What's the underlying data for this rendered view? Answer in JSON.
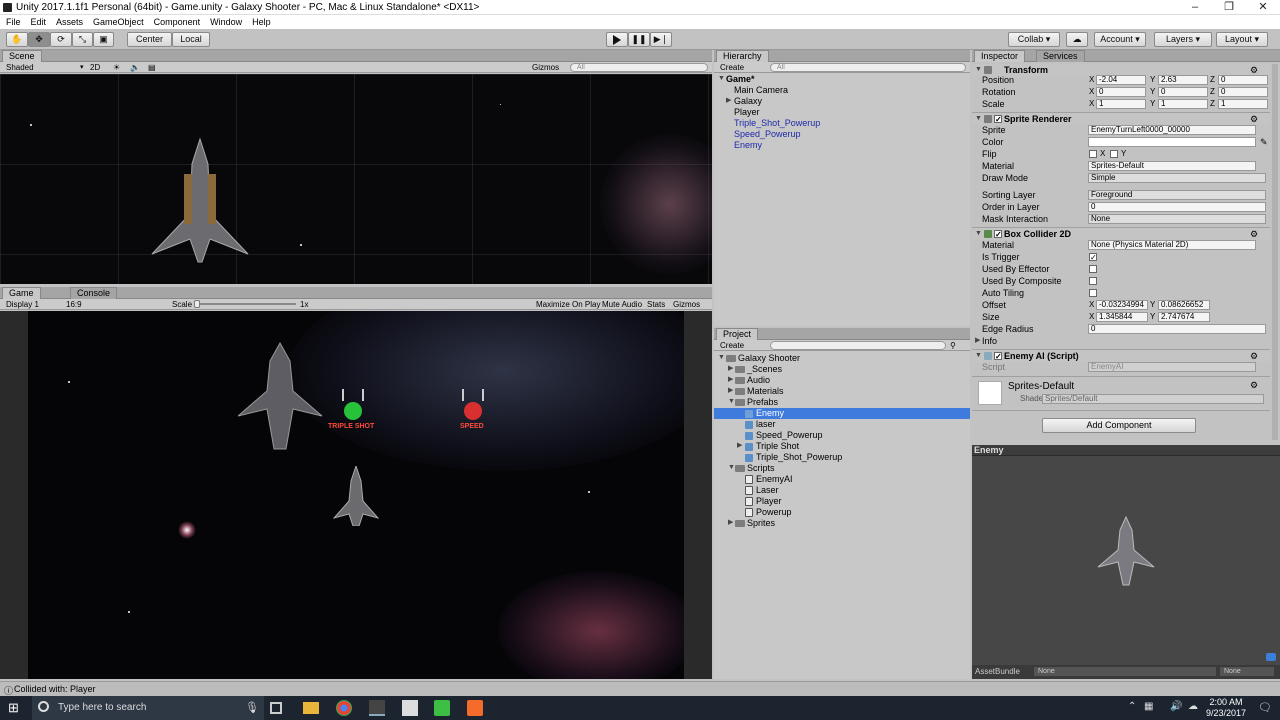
{
  "window": {
    "title": "Unity 2017.1.1f1 Personal (64bit) - Game.unity - Galaxy Shooter - PC, Mac & Linux Standalone* <DX11>"
  },
  "menu": [
    "File",
    "Edit",
    "Assets",
    "GameObject",
    "Component",
    "Window",
    "Help"
  ],
  "toolbar": {
    "center": "Center",
    "local": "Local",
    "collab": "Collab ▾",
    "account": "Account",
    "layers": "Layers",
    "layout": "Layout"
  },
  "scene": {
    "tab": "Scene",
    "shading": "Shaded",
    "mode2d": "2D",
    "gizmos": "Gizmos",
    "search_placeholder": "All"
  },
  "game": {
    "tab": "Game",
    "console_tab": "Console",
    "display": "Display 1",
    "aspect": "16:9",
    "scale_label": "Scale",
    "scale_value": "1x",
    "maximize": "Maximize On Play",
    "mute": "Mute Audio",
    "stats": "Stats",
    "gizmos": "Gizmos",
    "powerup1": "TRIPLE SHOT",
    "powerup2": "SPEED"
  },
  "hierarchy": {
    "tab": "Hierarchy",
    "create": "Create",
    "search_placeholder": "All",
    "scene_name": "Game*",
    "items": [
      "Main Camera",
      "Galaxy",
      "Player",
      "Triple_Shot_Powerup",
      "Speed_Powerup",
      "Enemy"
    ]
  },
  "project": {
    "tab": "Project",
    "create": "Create",
    "root": "Galaxy Shooter",
    "items": [
      "_Scenes",
      "Audio",
      "Materials",
      "Prefabs",
      "Enemy",
      "laser",
      "Speed_Powerup",
      "Triple Shot",
      "Triple_Shot_Powerup",
      "Scripts",
      "EnemyAI",
      "Laser",
      "Player",
      "Powerup",
      "Sprites"
    ]
  },
  "inspector": {
    "tab": "Inspector",
    "services_tab": "Services",
    "transform": {
      "title": "Transform",
      "position_label": "Position",
      "rotation_label": "Rotation",
      "scale_label": "Scale",
      "position": {
        "x": "-2.04",
        "y": "2.63",
        "z": "0"
      },
      "rotation": {
        "x": "0",
        "y": "0",
        "z": "0"
      },
      "scale": {
        "x": "1",
        "y": "1",
        "z": "1"
      }
    },
    "sprite_renderer": {
      "title": "Sprite Renderer",
      "sprite_label": "Sprite",
      "sprite": "EnemyTurnLeft0000_00000",
      "color_label": "Color",
      "flip_label": "Flip",
      "flip_x": "X",
      "flip_y": "Y",
      "material_label": "Material",
      "material": "Sprites-Default",
      "draw_mode_label": "Draw Mode",
      "draw_mode": "Simple",
      "sorting_layer_label": "Sorting Layer",
      "sorting_layer": "Foreground",
      "order_label": "Order in Layer",
      "order": "0",
      "mask_label": "Mask Interaction",
      "mask": "None"
    },
    "box_collider": {
      "title": "Box Collider 2D",
      "material_label": "Material",
      "material": "None (Physics Material 2D)",
      "trigger_label": "Is Trigger",
      "effector_label": "Used By Effector",
      "composite_label": "Used By Composite",
      "tiling_label": "Auto Tiling",
      "offset_label": "Offset",
      "offset": {
        "x": "-0.03234994",
        "y": "0.08626652"
      },
      "size_label": "Size",
      "size": {
        "x": "1.345844",
        "y": "2.747674"
      },
      "edge_label": "Edge Radius",
      "edge": "0",
      "info_label": "Info"
    },
    "script": {
      "title": "Enemy AI (Script)",
      "script_label": "Script",
      "script": "EnemyAI"
    },
    "material": {
      "name": "Sprites-Default",
      "shader_label": "Shader",
      "shader": "Sprites/Default"
    },
    "add_component": "Add Component",
    "preview_title": "Enemy",
    "assetbundle_label": "AssetBundle",
    "assetbundle": "None",
    "assetbundle_variant": "None"
  },
  "status": {
    "message": "Collided with: Player"
  },
  "taskbar": {
    "search": "Type here to search",
    "time": "2:00 AM",
    "date": "9/23/2017"
  }
}
